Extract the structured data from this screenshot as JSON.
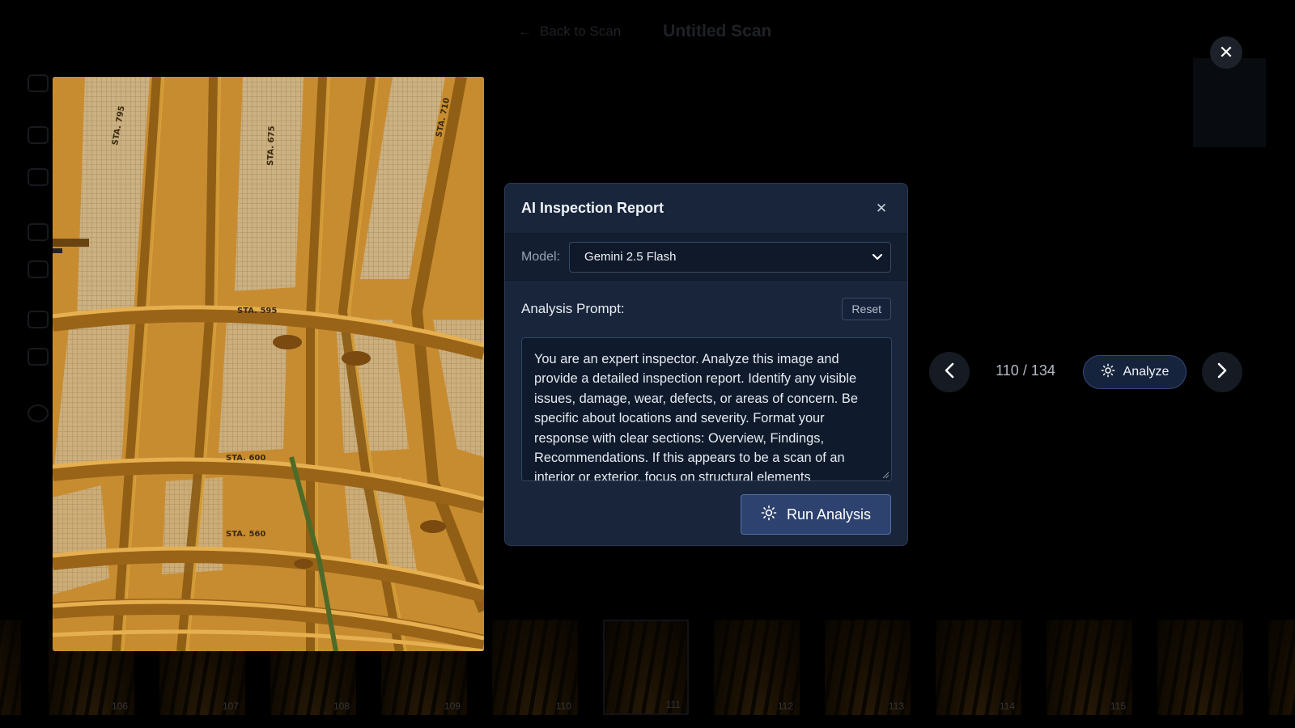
{
  "background": {
    "back_label": "Back to Scan",
    "scan_title": "Untitled Scan"
  },
  "filmstrip": {
    "thumbnails": [
      "106",
      "107",
      "108",
      "109",
      "110",
      "111",
      "112",
      "113",
      "114",
      "115"
    ]
  },
  "viewer": {
    "counter": "110 / 134",
    "analyze_label": "Analyze",
    "stencils": [
      "STA. 795",
      "STA. 675",
      "STA. 710",
      "STA. 595",
      "STA. 600",
      "STA. 560"
    ]
  },
  "modal": {
    "title": "AI Inspection Report",
    "model_label": "Model:",
    "model_selected": "Gemini 2.5 Flash",
    "prompt_label": "Analysis Prompt:",
    "reset_label": "Reset",
    "prompt_text": "You are an expert inspector. Analyze this image and provide a detailed inspection report. Identify any visible issues, damage, wear, defects, or areas of concern. Be specific about locations and severity. Format your response with clear sections: Overview, Findings, Recommendations. If this appears to be a scan of an interior or exterior, focus on structural elements",
    "run_label": "Run Analysis"
  },
  "icons": {
    "close": "close-icon",
    "prev": "chevron-left-icon",
    "next": "chevron-right-icon",
    "analyze": "sparkle-sun-icon"
  },
  "colors": {
    "modal_bg": "#18253a",
    "accent": "#2e426f",
    "image_tone": "#c4862c"
  }
}
